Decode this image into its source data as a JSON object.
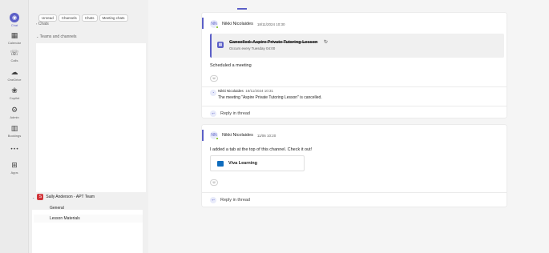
{
  "rail": {
    "items": [
      {
        "label": "Chat",
        "icon": "chat-icon",
        "glyph": "◉",
        "active": true
      },
      {
        "label": "Calendar",
        "icon": "calendar-icon",
        "glyph": "▦"
      },
      {
        "label": "Calls",
        "icon": "phone-icon",
        "glyph": "☏"
      },
      {
        "label": "OneDrive",
        "icon": "cloud-icon",
        "glyph": "☁"
      },
      {
        "label": "Copilot",
        "icon": "copilot-icon",
        "glyph": "❀"
      },
      {
        "label": "Admin",
        "icon": "admin-icon",
        "glyph": "⚙"
      },
      {
        "label": "Bookings",
        "icon": "bookings-icon",
        "glyph": "▥"
      },
      {
        "label": "",
        "icon": "more-icon",
        "glyph": "•••"
      },
      {
        "label": "Apps",
        "icon": "apps-icon",
        "glyph": "⊞"
      }
    ]
  },
  "list": {
    "filters": [
      "Unread",
      "Channels",
      "Chats",
      "Meeting chats"
    ],
    "chats_header": "Chats",
    "teams_header": "Teams and channels",
    "team_name": "Sally Anderson - APT Team",
    "team_initial": "S",
    "channels": [
      "General",
      "Lesson Materials"
    ]
  },
  "messages": {
    "first": {
      "author": "Nikki Nicolaides",
      "time": "18/11/2024 10:30",
      "meeting_title": "Cancelled: Aspire Private Tutoring Lesson",
      "meeting_sub": "Occurs every Tuesday 04:00",
      "body": "Scheduled a meeting",
      "sys_author": "Nikki Nicolaides",
      "sys_time": "18/11/2024 10:31",
      "sys_text": "The meeting \"Aspire Private Tutoring Lesson\" is cancelled.",
      "reply": "Reply in thread"
    },
    "second": {
      "author": "Nikki Nicolaides",
      "time": "11/06 10:20",
      "body": "I added a tab at the top of this channel. Check it out!",
      "tab_name": "Viva Learning",
      "reply": "Reply in thread"
    }
  }
}
